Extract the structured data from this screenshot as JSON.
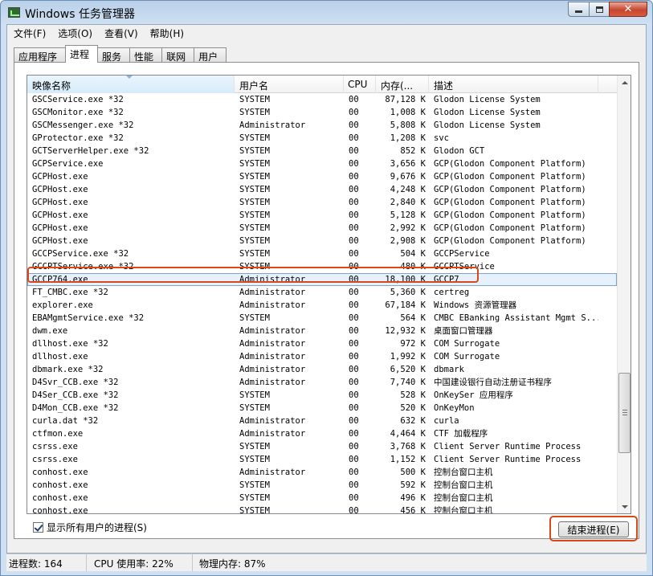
{
  "window": {
    "title": "Windows 任务管理器"
  },
  "menu": [
    "文件(F)",
    "选项(O)",
    "查看(V)",
    "帮助(H)"
  ],
  "tabs": [
    {
      "label": "应用程序",
      "active": false
    },
    {
      "label": "进程",
      "active": true
    },
    {
      "label": "服务",
      "active": false
    },
    {
      "label": "性能",
      "active": false
    },
    {
      "label": "联网",
      "active": false
    },
    {
      "label": "用户",
      "active": false
    }
  ],
  "columns": {
    "name": "映像名称",
    "user": "用户名",
    "cpu": "CPU",
    "mem": "内存(...",
    "desc": "描述"
  },
  "processes": [
    [
      "GSCService.exe *32",
      "SYSTEM",
      "00",
      "87,128 K",
      "Glodon License System"
    ],
    [
      "GSCMonitor.exe *32",
      "SYSTEM",
      "00",
      "1,008 K",
      "Glodon License System"
    ],
    [
      "GSCMessenger.exe *32",
      "Administrator",
      "00",
      "5,808 K",
      "Glodon License System"
    ],
    [
      "GProtector.exe *32",
      "SYSTEM",
      "00",
      "1,208 K",
      "svc"
    ],
    [
      "GCTServerHelper.exe *32",
      "SYSTEM",
      "00",
      "852 K",
      "Glodon GCT"
    ],
    [
      "GCPService.exe",
      "SYSTEM",
      "00",
      "3,656 K",
      "GCP(Glodon Component Platform)"
    ],
    [
      "GCPHost.exe",
      "SYSTEM",
      "00",
      "9,676 K",
      "GCP(Glodon Component Platform)"
    ],
    [
      "GCPHost.exe",
      "SYSTEM",
      "00",
      "4,248 K",
      "GCP(Glodon Component Platform)"
    ],
    [
      "GCPHost.exe",
      "SYSTEM",
      "00",
      "2,840 K",
      "GCP(Glodon Component Platform)"
    ],
    [
      "GCPHost.exe",
      "SYSTEM",
      "00",
      "5,128 K",
      "GCP(Glodon Component Platform)"
    ],
    [
      "GCPHost.exe",
      "SYSTEM",
      "00",
      "2,992 K",
      "GCP(Glodon Component Platform)"
    ],
    [
      "GCPHost.exe",
      "SYSTEM",
      "00",
      "2,908 K",
      "GCP(Glodon Component Platform)"
    ],
    [
      "GCCPService.exe *32",
      "SYSTEM",
      "00",
      "504 K",
      "GCCPService"
    ],
    [
      "GCCPTService.exe *32",
      "SYSTEM",
      "00",
      "480 K",
      "GCCPTService"
    ],
    [
      "GCCP764.exe",
      "Administrator",
      "00",
      "18,100 K",
      "GCCP7"
    ],
    [
      "FT_CMBC.exe *32",
      "Administrator",
      "00",
      "5,360 K",
      "certreg"
    ],
    [
      "explorer.exe",
      "Administrator",
      "00",
      "67,184 K",
      "Windows 资源管理器"
    ],
    [
      "EBAMgmtService.exe *32",
      "SYSTEM",
      "00",
      "564 K",
      "CMBC EBanking Assistant Mgmt S..."
    ],
    [
      "dwm.exe",
      "Administrator",
      "00",
      "12,932 K",
      "桌面窗口管理器"
    ],
    [
      "dllhost.exe *32",
      "Administrator",
      "00",
      "972 K",
      "COM Surrogate"
    ],
    [
      "dllhost.exe",
      "Administrator",
      "00",
      "1,992 K",
      "COM Surrogate"
    ],
    [
      "dbmark.exe *32",
      "Administrator",
      "00",
      "6,520 K",
      "dbmark"
    ],
    [
      "D4Svr_CCB.exe *32",
      "Administrator",
      "00",
      "7,740 K",
      "中国建设银行自动注册证书程序"
    ],
    [
      "D4Ser_CCB.exe *32",
      "SYSTEM",
      "00",
      "528 K",
      "OnKeySer 应用程序"
    ],
    [
      "D4Mon_CCB.exe *32",
      "SYSTEM",
      "00",
      "520 K",
      "OnKeyMon"
    ],
    [
      "curla.dat *32",
      "Administrator",
      "00",
      "632 K",
      "curla"
    ],
    [
      "ctfmon.exe",
      "Administrator",
      "00",
      "4,464 K",
      "CTF 加载程序"
    ],
    [
      "csrss.exe",
      "SYSTEM",
      "00",
      "3,768 K",
      "Client Server Runtime Process"
    ],
    [
      "csrss.exe",
      "SYSTEM",
      "00",
      "1,152 K",
      "Client Server Runtime Process"
    ],
    [
      "conhost.exe",
      "Administrator",
      "00",
      "500 K",
      "控制台窗口主机"
    ],
    [
      "conhost.exe",
      "SYSTEM",
      "00",
      "592 K",
      "控制台窗口主机"
    ],
    [
      "conhost.exe",
      "SYSTEM",
      "00",
      "496 K",
      "控制台窗口主机"
    ],
    [
      "conhost.exe",
      "SYSTEM",
      "00",
      "456 K",
      "控制台窗口主机"
    ]
  ],
  "selected_process": "GCCP764.exe",
  "show_all_users": {
    "label": "显示所有用户的进程(S)",
    "checked": true
  },
  "end_process_button": "结束进程(E)",
  "status": {
    "processes": "进程数: 164",
    "cpu": "CPU 使用率: 22%",
    "memory": "物理内存: 87%"
  },
  "colors": {
    "highlight_annotation": "#d9471b",
    "title_gradient": "#cfe0f2"
  }
}
